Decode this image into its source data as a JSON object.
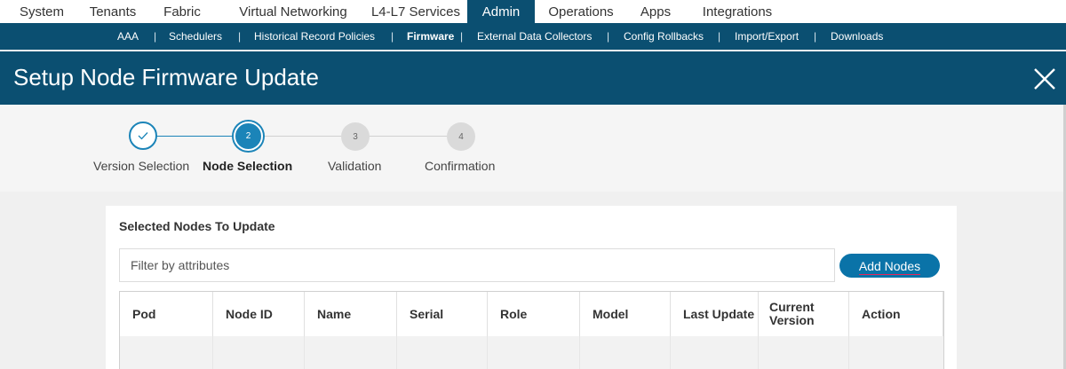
{
  "topnav": {
    "tabs": [
      {
        "label": "System"
      },
      {
        "label": "Tenants"
      },
      {
        "label": "Fabric"
      },
      {
        "label": "Virtual Networking"
      },
      {
        "label": "L4-L7 Services"
      },
      {
        "label": "Admin",
        "active": true
      },
      {
        "label": "Operations"
      },
      {
        "label": "Apps"
      },
      {
        "label": "Integrations"
      }
    ]
  },
  "subnav": {
    "items": [
      {
        "label": "AAA"
      },
      {
        "label": "Schedulers"
      },
      {
        "label": "Historical Record Policies"
      },
      {
        "label": "Firmware",
        "active": true
      },
      {
        "label": "External Data Collectors"
      },
      {
        "label": "Config Rollbacks"
      },
      {
        "label": "Import/Export"
      },
      {
        "label": "Downloads"
      }
    ],
    "separator": "|"
  },
  "header": {
    "title": "Setup Node Firmware Update",
    "close_icon": "close-icon"
  },
  "stepper": {
    "steps": [
      {
        "number": "",
        "label": "Version Selection",
        "state": "completed",
        "icon": "check-icon"
      },
      {
        "number": "2",
        "label": "Node Selection",
        "state": "current"
      },
      {
        "number": "3",
        "label": "Validation",
        "state": "pending"
      },
      {
        "number": "4",
        "label": "Confirmation",
        "state": "pending"
      }
    ]
  },
  "panel": {
    "title": "Selected Nodes To Update",
    "filter_placeholder": "Filter by attributes",
    "filter_value": "",
    "add_nodes_label": "Add Nodes",
    "table": {
      "columns": [
        "Pod",
        "Node ID",
        "Name",
        "Serial",
        "Role",
        "Model",
        "Last Update",
        "Current Version",
        "Action"
      ],
      "rows": []
    }
  },
  "colors": {
    "nav_dark": "#0b4f71",
    "accent": "#0a73a8",
    "completed": "#1b84b8",
    "pending": "#d9d9d9",
    "spellcheck_underline": "#e8245a"
  }
}
